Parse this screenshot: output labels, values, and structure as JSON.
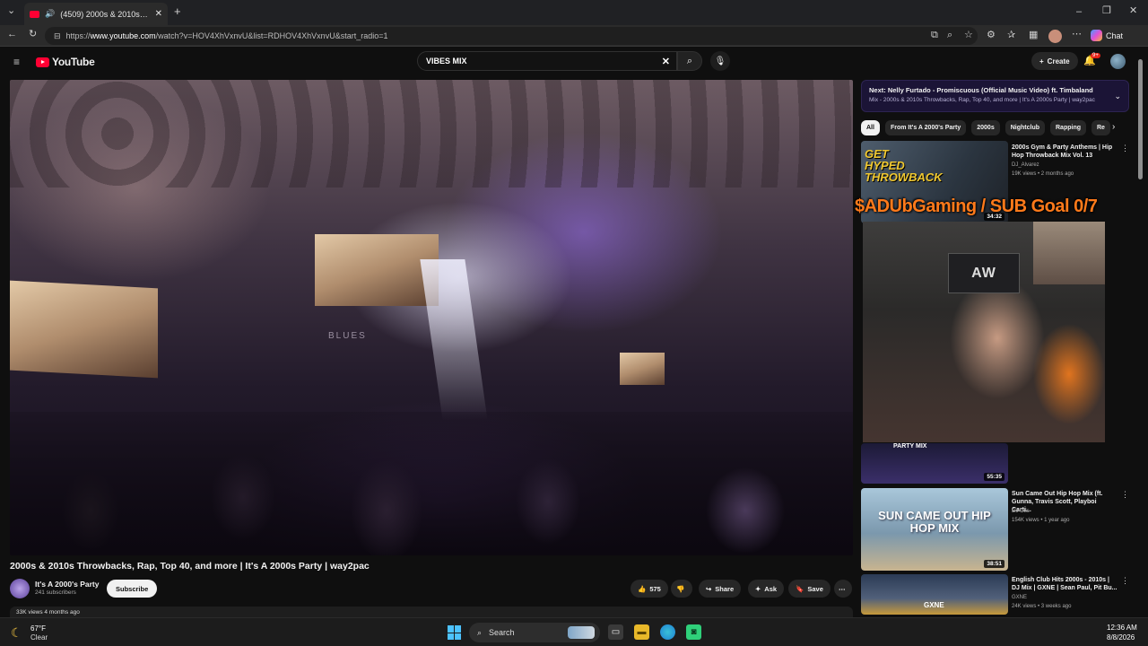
{
  "browser": {
    "tab_title": "(4509) 2000s & 2010s Throwb",
    "url_prefix": "https://",
    "url_host": "www.youtube.com",
    "url_path": "/watch?v=HOV4XhVxnvU&list=RDHOV4XhVxnvU&start_radio=1",
    "chat_label": "Chat"
  },
  "header": {
    "logo_text": "YouTube",
    "search_value": "VIBES MIX",
    "create_label": "Create",
    "notif_count": "9+"
  },
  "video": {
    "title": "2000s & 2010s Throwbacks, Rap, Top 40, and more | It's A 2000s Party | way2pac",
    "channel_name": "It's A 2000's Party",
    "channel_subs": "241 subscribers",
    "subscribe_label": "Subscribe",
    "likes": "575",
    "share_label": "Share",
    "ask_label": "Ask",
    "save_label": "Save",
    "views_line": "33K views  4 months ago",
    "screen_text": "BLUES"
  },
  "next_up": {
    "title": "Next: Nelly Furtado - Promiscuous (Official Music Video) ft. Timbaland",
    "subtitle": "Mix - 2000s & 2010s Throwbacks, Rap, Top 40, and more | It's A 2000s Party | way2pac"
  },
  "chips": [
    "All",
    "From It's A 2000's Party",
    "2000s",
    "Nightclub",
    "Rapping",
    "Re"
  ],
  "recommendations": [
    {
      "title": "2000s Gym & Party Anthems | Hip Hop Throwback Mix Vol. 13",
      "channel": "DJ_Alvarez",
      "meta": "19K views • 2 months ago",
      "duration": "34:32",
      "thumb_text": "GET HYPED THROWBACK",
      "colors": [
        "#3b4a5a",
        "#f0c830"
      ]
    },
    {
      "title": "",
      "channel": "",
      "meta": "",
      "duration": "55:35",
      "thumb_text": "PARTY MIX",
      "colors": [
        "#15142a",
        "#5b4aa0"
      ]
    },
    {
      "title": "Sun Came Out Hip Hop Mix (ft. Gunna, Travis Scott, Playboi Carti...",
      "channel": "DJ Otis",
      "meta": "154K views • 1 year ago",
      "duration": "38:51",
      "thumb_text": "SUN CAME OUT HIP HOP MIX",
      "colors": [
        "#8fb5cc",
        "#d8c7a8"
      ]
    },
    {
      "title": "English Club Hits 2000s - 2010s | DJ Mix | GXNE | Sean Paul, Pit Bu...",
      "channel": "GXNE",
      "meta": "24K views • 3 weeks ago",
      "duration": "",
      "thumb_text": "GXNE",
      "colors": [
        "#2a3a52",
        "#e0b040"
      ]
    }
  ],
  "overlay": {
    "goal_text": "$ADUbGaming / SUB Goal 0/7",
    "poster_text": "AW"
  },
  "taskbar": {
    "temp": "67°F",
    "weather": "Clear",
    "search_label": "Search",
    "time": "12:36 AM",
    "date": "8/8/2026"
  }
}
